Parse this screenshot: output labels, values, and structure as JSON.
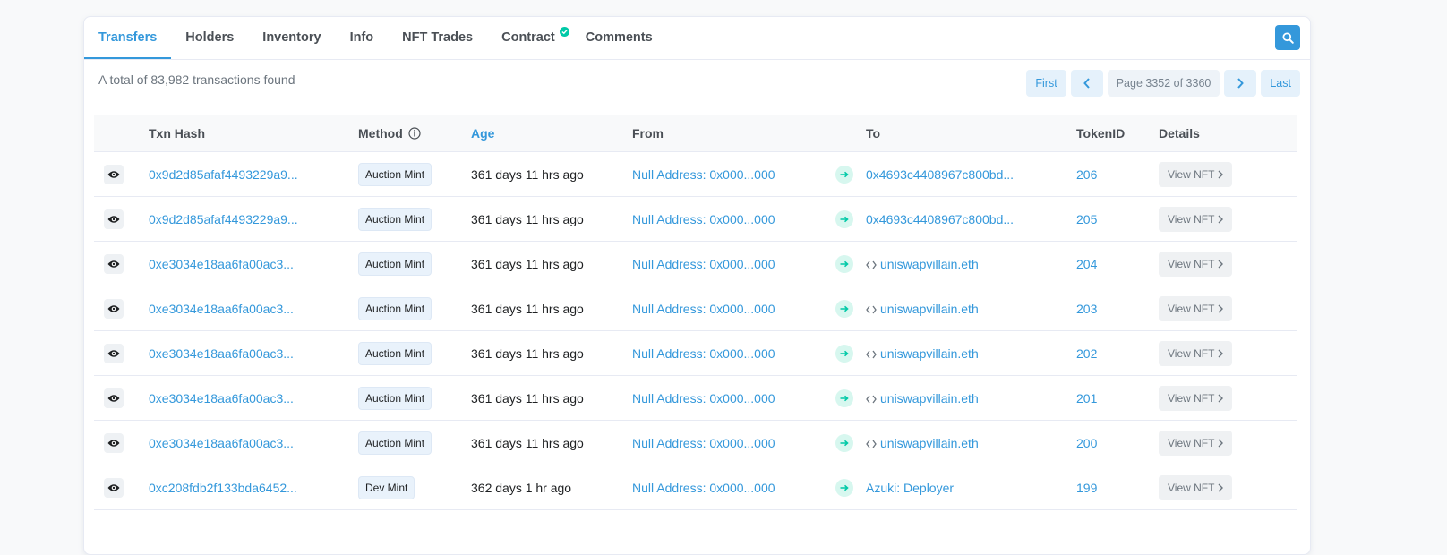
{
  "tabs": [
    {
      "label": "Transfers",
      "active": true
    },
    {
      "label": "Holders",
      "active": false
    },
    {
      "label": "Inventory",
      "active": false
    },
    {
      "label": "Info",
      "active": false
    },
    {
      "label": "NFT Trades",
      "active": false
    },
    {
      "label": "Contract",
      "active": false,
      "verified": true
    },
    {
      "label": "Comments",
      "active": false
    }
  ],
  "summary": "A total of 83,982 transactions found",
  "pagination": {
    "first": "First",
    "page_info": "Page 3352 of 3360",
    "last": "Last"
  },
  "columns": {
    "txn_hash": "Txn Hash",
    "method": "Method",
    "age": "Age",
    "from": "From",
    "to": "To",
    "token_id": "TokenID",
    "details": "Details"
  },
  "view_label": "View NFT",
  "rows": [
    {
      "hash": "0x9d2d85afaf4493229a9...",
      "method": "Auction Mint",
      "age": "361 days 11 hrs ago",
      "from": "Null Address: 0x000...000",
      "to": "0x4693c4408967c800bd...",
      "to_contract": false,
      "token": "206"
    },
    {
      "hash": "0x9d2d85afaf4493229a9...",
      "method": "Auction Mint",
      "age": "361 days 11 hrs ago",
      "from": "Null Address: 0x000...000",
      "to": "0x4693c4408967c800bd...",
      "to_contract": false,
      "token": "205"
    },
    {
      "hash": "0xe3034e18aa6fa00ac3...",
      "method": "Auction Mint",
      "age": "361 days 11 hrs ago",
      "from": "Null Address: 0x000...000",
      "to": "uniswapvillain.eth",
      "to_contract": true,
      "token": "204"
    },
    {
      "hash": "0xe3034e18aa6fa00ac3...",
      "method": "Auction Mint",
      "age": "361 days 11 hrs ago",
      "from": "Null Address: 0x000...000",
      "to": "uniswapvillain.eth",
      "to_contract": true,
      "token": "203"
    },
    {
      "hash": "0xe3034e18aa6fa00ac3...",
      "method": "Auction Mint",
      "age": "361 days 11 hrs ago",
      "from": "Null Address: 0x000...000",
      "to": "uniswapvillain.eth",
      "to_contract": true,
      "token": "202"
    },
    {
      "hash": "0xe3034e18aa6fa00ac3...",
      "method": "Auction Mint",
      "age": "361 days 11 hrs ago",
      "from": "Null Address: 0x000...000",
      "to": "uniswapvillain.eth",
      "to_contract": true,
      "token": "201"
    },
    {
      "hash": "0xe3034e18aa6fa00ac3...",
      "method": "Auction Mint",
      "age": "361 days 11 hrs ago",
      "from": "Null Address: 0x000...000",
      "to": "uniswapvillain.eth",
      "to_contract": true,
      "token": "200"
    },
    {
      "hash": "0xc208fdb2f133bda6452...",
      "method": "Dev Mint",
      "age": "362 days 1 hr ago",
      "from": "Null Address: 0x000...000",
      "to": "Azuki: Deployer",
      "to_contract": false,
      "token": "199"
    }
  ]
}
